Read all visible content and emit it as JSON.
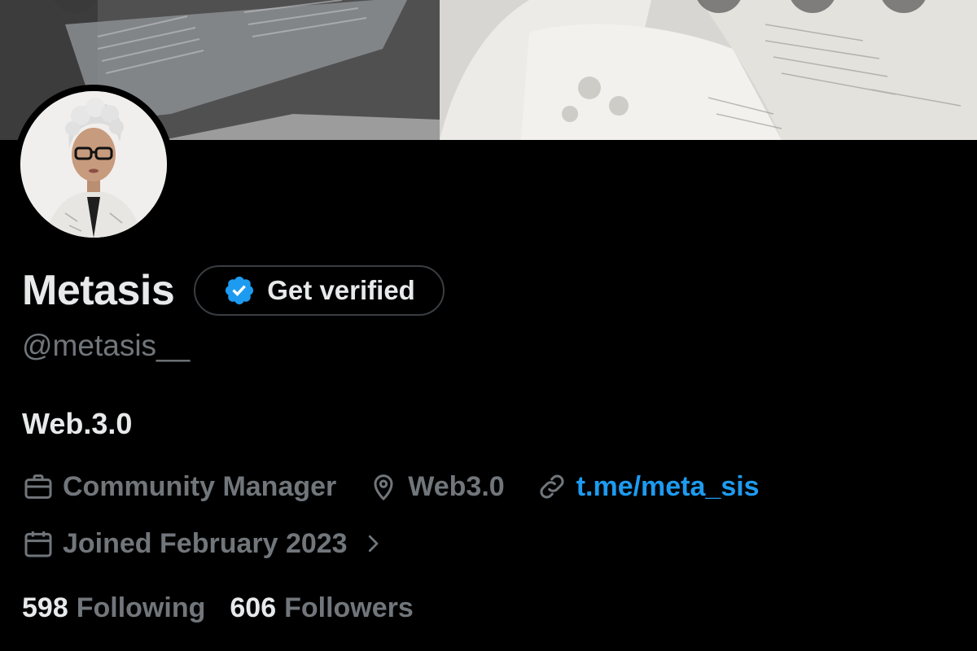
{
  "profile": {
    "display_name": "Metasis",
    "handle": "@metasis__",
    "bio": "Web.3.0",
    "verify_label": "Get verified",
    "job": "Community Manager",
    "location": "Web3.0",
    "link": "t.me/meta_sis",
    "joined": "Joined February 2023",
    "following_count": "598",
    "following_label": "Following",
    "followers_count": "606",
    "followers_label": "Followers"
  },
  "icons": {
    "verify": "verified-badge-icon",
    "job": "briefcase-icon",
    "location": "location-pin-icon",
    "link": "link-icon",
    "joined": "calendar-icon",
    "more": "chevron-right-icon"
  },
  "colors": {
    "background": "#000000",
    "text_primary": "#e7e9ea",
    "text_secondary": "#71767b",
    "accent": "#1d9bf0",
    "border": "#3a3e42"
  }
}
